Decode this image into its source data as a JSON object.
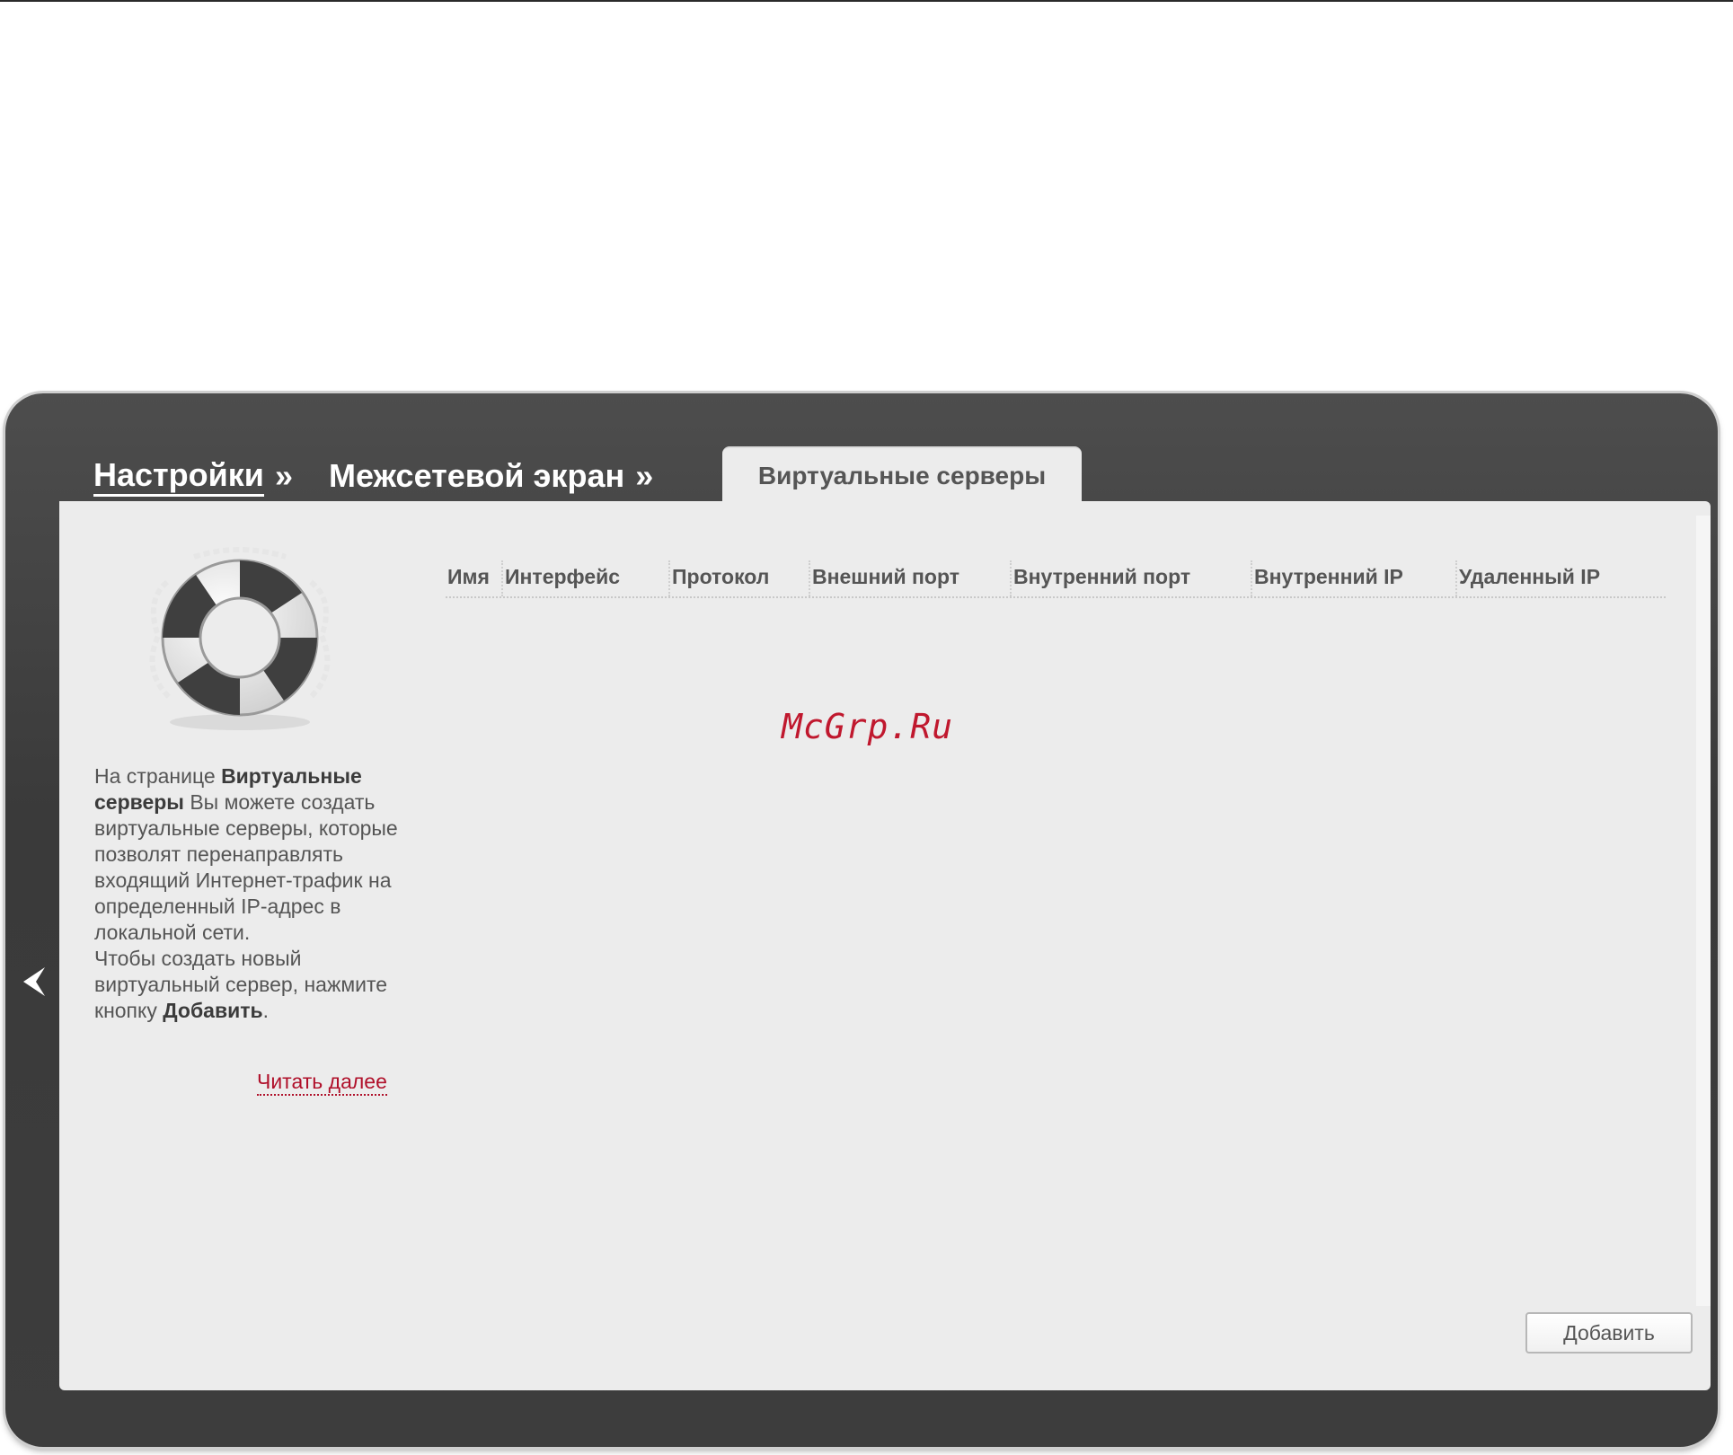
{
  "breadcrumb": {
    "items": [
      {
        "label": "Настройки",
        "sep": "»"
      },
      {
        "label": "Межсетевой экран",
        "sep": "»"
      }
    ],
    "active_tab": "Виртуальные серверы"
  },
  "help": {
    "intro_prefix": "На странице ",
    "intro_bold": "Виртуальные серверы",
    "intro_rest": " Вы можете создать виртуальные серверы, которые позволят перенаправлять входящий Интернет-трафик на определенный IP-адрес в локальной сети.",
    "create_prefix": "Чтобы создать новый виртуальный сервер, нажмите кнопку ",
    "create_bold": "Добавить",
    "create_suffix": ".",
    "read_more": "Читать далее"
  },
  "table": {
    "columns": [
      "Имя",
      "Интерфейс",
      "Протокол",
      "Внешний порт",
      "Внутренний порт",
      "Внутренний IP",
      "Удаленный IP"
    ],
    "rows": []
  },
  "watermark": "McGrp.Ru",
  "buttons": {
    "add": "Добавить"
  },
  "icons": {
    "collapse": "chevron-left-icon",
    "help": "lifebuoy-icon"
  },
  "colors": {
    "frame": "#444444",
    "panel": "#ececec",
    "link": "#b0102a"
  }
}
